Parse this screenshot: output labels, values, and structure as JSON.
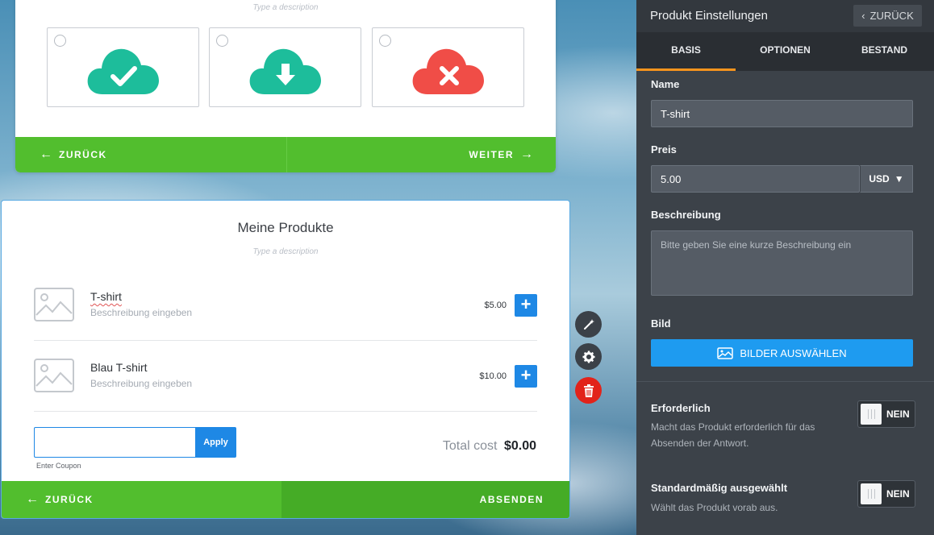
{
  "top_form": {
    "description_placeholder": "Type a description",
    "choices": [
      {
        "icon": "cloud-check-icon",
        "color": "#1dbd9b"
      },
      {
        "icon": "cloud-download-icon",
        "color": "#1dbd9b"
      },
      {
        "icon": "cloud-cross-icon",
        "color": "#f04d47"
      }
    ],
    "nav": {
      "back_label": "ZURÜCK",
      "next_label": "WEITER"
    }
  },
  "product_form": {
    "title": "Meine Produkte",
    "description_placeholder": "Type a description",
    "products": [
      {
        "name": "T-shirt",
        "description": "Beschreibung eingeben",
        "price": "$5.00",
        "add_label": "+"
      },
      {
        "name": "Blau T-shirt",
        "description": "Beschreibung eingeben",
        "price": "$10.00",
        "add_label": "+"
      }
    ],
    "coupon": {
      "value": "",
      "apply_label": "Apply",
      "label": "Enter Coupon"
    },
    "total": {
      "label": "Total cost",
      "value": "$0.00"
    },
    "nav": {
      "back_label": "ZURÜCK",
      "submit_label": "ABSENDEN"
    }
  },
  "tools": [
    "magic-wand-icon",
    "gear-icon",
    "trash-icon"
  ],
  "panel": {
    "title": "Produkt Einstellungen",
    "back_label": "ZURÜCK",
    "tabs": [
      {
        "label": "BASIS",
        "active": true
      },
      {
        "label": "OPTIONEN",
        "active": false
      },
      {
        "label": "BESTAND",
        "active": false
      }
    ],
    "name": {
      "label": "Name",
      "value": "T-shirt"
    },
    "price": {
      "label": "Preis",
      "value": "5.00",
      "currency": "USD"
    },
    "description": {
      "label": "Beschreibung",
      "placeholder": "Bitte geben Sie eine kurze Beschreibung ein"
    },
    "image": {
      "label": "Bild",
      "button_label": "BILDER AUSWÄHLEN"
    },
    "required": {
      "label": "Erforderlich",
      "hint": "Macht das Produkt erforderlich für das Absenden der Antwort.",
      "toggle": "NEIN"
    },
    "default_selected": {
      "label": "Standardmäßig ausgewählt",
      "hint": "Wählt das Produkt vorab aus.",
      "toggle": "NEIN"
    }
  },
  "colors": {
    "green": "#52be2e",
    "blue": "#1e88e5",
    "accent": "#f7941d",
    "panel": "#3c4249"
  }
}
